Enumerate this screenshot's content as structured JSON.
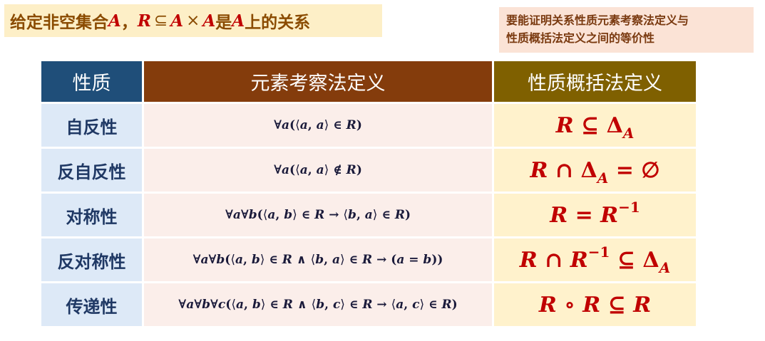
{
  "header": {
    "title_prefix": "给定非空集合",
    "set_a": "A",
    "comma": "，",
    "rel_r": "R",
    "subseteq": "⊆",
    "cross": "×",
    "is": "是",
    "on": "上的关系"
  },
  "note": {
    "line1": "要能证明关系性质元素考察法定义与",
    "line2": "性质概括法定义之间的等价性"
  },
  "table": {
    "headers": [
      "性质",
      "元素考察法定义",
      "性质概括法定义"
    ],
    "rows": [
      {
        "property": "自反性",
        "element_def": "∀a(⟨a, a⟩ ∈ R)",
        "summary_def": "R ⊆ Δ_A"
      },
      {
        "property": "反自反性",
        "element_def": "∀a(⟨a, a⟩ ∉ R)",
        "summary_def": "R ∩ Δ_A = ∅"
      },
      {
        "property": "对称性",
        "element_def": "∀a∀b(⟨a, b⟩ ∈ R → ⟨b, a⟩ ∈ R)",
        "summary_def": "R = R^−1"
      },
      {
        "property": "反对称性",
        "element_def": "∀a∀b(⟨a, b⟩ ∈ R ∧ ⟨b, a⟩ ∈ R → (a = b))",
        "summary_def": "R ∩ R^−1 ⊆ Δ_A"
      },
      {
        "property": "传递性",
        "element_def": "∀a∀b∀c(⟨a, b⟩ ∈ R ∧ ⟨b, c⟩ ∈ R → ⟨a, c⟩ ∈ R)",
        "summary_def": "R ∘ R ⊆ R"
      }
    ]
  },
  "colors": {
    "header_property": "#1f4e79",
    "header_element": "#843c0c",
    "header_summary": "#7f6000",
    "formula_red": "#c00000"
  }
}
